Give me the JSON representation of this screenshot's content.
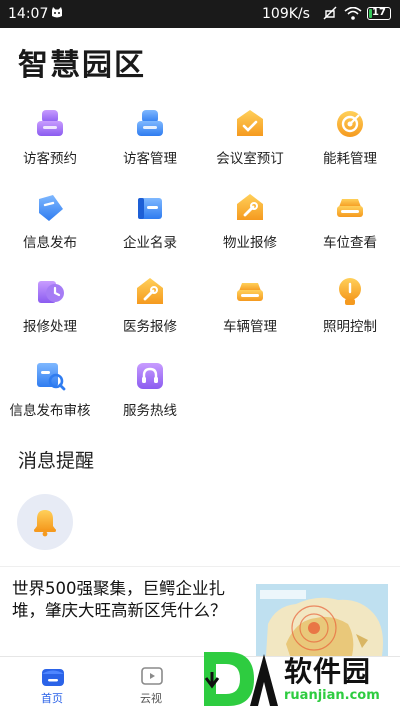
{
  "status_bar": {
    "time": "14:07",
    "speed": "109K/s",
    "battery": "17",
    "battery_level": 0.17
  },
  "page": {
    "title": "智慧园区"
  },
  "services": [
    {
      "label": "访客预约",
      "icon": "visitor-booking-icon"
    },
    {
      "label": "访客管理",
      "icon": "visitor-management-icon"
    },
    {
      "label": "会议室预订",
      "icon": "meeting-room-icon"
    },
    {
      "label": "能耗管理",
      "icon": "energy-icon"
    },
    {
      "label": "信息发布",
      "icon": "info-publish-icon"
    },
    {
      "label": "企业名录",
      "icon": "company-directory-icon"
    },
    {
      "label": "物业报修",
      "icon": "property-repair-icon"
    },
    {
      "label": "车位查看",
      "icon": "parking-icon"
    },
    {
      "label": "报修处理",
      "icon": "repair-process-icon"
    },
    {
      "label": "医务报修",
      "icon": "medical-repair-icon"
    },
    {
      "label": "车辆管理",
      "icon": "vehicle-icon"
    },
    {
      "label": "照明控制",
      "icon": "lighting-icon"
    },
    {
      "label": "信息发布审核",
      "icon": "publish-review-icon"
    },
    {
      "label": "服务热线",
      "icon": "hotline-icon"
    }
  ],
  "reminders": {
    "title": "消息提醒",
    "icon": "bell-icon"
  },
  "news": {
    "title": "世界500强聚集，巨鳄企业扎堆，肇庆大旺高新区凭什么？",
    "image": "map-thumbnail"
  },
  "tabs": [
    {
      "label": "首页",
      "icon": "home-icon",
      "active": true
    },
    {
      "label": "云视",
      "icon": "video-icon",
      "active": false
    }
  ],
  "watermark": {
    "text": "软件园",
    "url": "ruanjian.com"
  },
  "colors": {
    "accent": "#2b63e8",
    "orange": "#f5a623",
    "purple": "#9b6cf0",
    "blue": "#3f8cf2",
    "status_bar": "#1a1a1a"
  }
}
